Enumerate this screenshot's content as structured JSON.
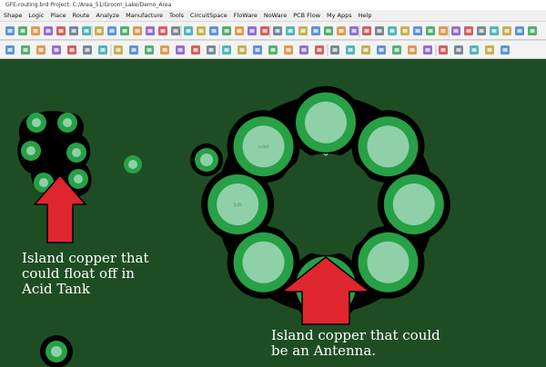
{
  "window": {
    "title": "GFE-routing.brd  Project: C:/Area_51/Groom_Lake/Demo_Area"
  },
  "menu": {
    "items": [
      "Shape",
      "Logic",
      "Place",
      "Route",
      "Analyze",
      "Manufacture",
      "Tools",
      "CircuitSpace",
      "FloWare",
      "NoWare",
      "PCB Flow",
      "My Apps",
      "Help"
    ]
  },
  "toolbar": {
    "row1_icons": [
      "undo-icon",
      "redo-icon",
      "route-icon",
      "drc-icon",
      "grid-icon",
      "zoom-in-icon",
      "zoom-out-icon",
      "zoom-fit-icon",
      "zoom-prev-icon",
      "zoom-window-icon",
      "zoom-world-icon",
      "refresh-icon",
      "view-3d-icon",
      "layer-icon",
      "pen-icon",
      "shape-icon",
      "copy-icon",
      "move-icon",
      "delete-icon",
      "measure-icon",
      "find-icon",
      "report-icon",
      "text-icon",
      "pin-icon",
      "via-icon",
      "highlight-icon",
      "color-icon",
      "visibility-icon",
      "save-icon",
      "print-icon",
      "help-icon",
      "info-icon",
      "option-icon",
      "dimension-icon",
      "swap-icon",
      "flow-icon",
      "chart-icon",
      "net-icon",
      "app-icon",
      "settings-icon",
      "tile-icon",
      "export-icon"
    ],
    "row2_icons": [
      "select-icon",
      "add-connect-icon",
      "slide-icon",
      "fanout-icon",
      "delay-tune-icon",
      "spread-icon",
      "custom-smooth-icon",
      "vertex-icon",
      "cline-icon",
      "glossing-icon",
      "bundle-icon",
      "flow-plan-icon",
      "diff-pair-icon",
      "rat-icon",
      "ratsnest-icon",
      "net-schedule-icon",
      "shove-icon",
      "via-add-icon",
      "plane-icon",
      "void-icon",
      "merge-icon",
      "split-icon",
      "fill-icon",
      "boundary-icon",
      "assign-net-icon",
      "hourglass-icon",
      "alert-icon",
      "check-icon",
      "cross-section-icon",
      "power-icon",
      "signal-icon",
      "auto-route-icon",
      "timing-icon"
    ],
    "accent_color": "#2b6fd6"
  },
  "board": {
    "background_color": "#1e4d24",
    "pad_color": "#27a046",
    "pad_drill_color": "#8fd0a8",
    "outline_color": "#000000",
    "arrow_color": "#e0262d",
    "pad_labels": [
      "",
      "",
      "",
      "",
      "1:23",
      "",
      "1:25",
      "s:ctet"
    ]
  },
  "annotations": {
    "left": "Island copper that\ncould float off in\nAcid Tank",
    "right": "Island copper that could\nbe an Antenna."
  }
}
